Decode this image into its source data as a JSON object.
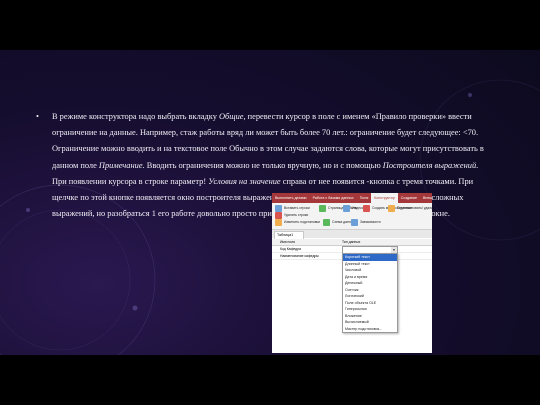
{
  "slide": {
    "bullet": "•",
    "paragraph": [
      {
        "t": "В режиме конструктора надо выбрать вкладку ",
        "i": false
      },
      {
        "t": "Общие",
        "i": true
      },
      {
        "t": ", перевести курсор в поле с именем «Правило проверки» ввести ограничение на данные. Например, стаж работы вряд ли может быть более 70 лет.: ограничение будет следующее: <70. Ограничение можно вводить и на текстовое поле Обычно в этом случае задаются слова, которые могут присутствовать в данном поле ",
        "i": false
      },
      {
        "t": "Примечание",
        "i": true
      },
      {
        "t": ". Вводить ограничения можно не только вручную, но и с помощью ",
        "i": false
      },
      {
        "t": "Построителя выражений",
        "i": true
      },
      {
        "t": ". При появлении курсора в строке параметр! ",
        "i": false
      },
      {
        "t": "Условия на значение",
        "i": true
      },
      {
        "t": " справа от нее появится -кнопка с тремя точками. При щелчке по этой кнопке появляется окно построителя выражений. Обычно им пользуются для построения сложных выражений, но разобраться 1 его работе довольно просто при помощи справки, расположенной в этом же окне.",
        "i": false
      }
    ]
  },
  "screenshot": {
    "tabs": [
      "Выполнить датами",
      "Работа с базами данных",
      "Поля",
      "Конструктор",
      "Создание",
      "Внешние"
    ],
    "active_tab_index": 3,
    "ribbon": {
      "commands": [
        "Вставить строки",
        "Удалить строки",
        "Изменить подстановки",
        "Страница свойств",
        "Индексы",
        "Создать макросы данных",
        "Переименовать/ удалить макрос",
        "Схема данных",
        "Зависимости"
      ],
      "colors": [
        "#6a9fd8",
        "#d9534f",
        "#f0ad4e",
        "#5cb85c"
      ]
    },
    "object_tab": "Таблица1",
    "grid": {
      "headers": [
        "Имя поля",
        "Тип данных"
      ],
      "rows": [
        [
          "Код Кафедра",
          "Короткий текст"
        ],
        [
          "Наименование кафедры",
          "Короткий текст"
        ]
      ]
    },
    "dropdown": {
      "selected": "Короткий текст",
      "options": [
        "Короткий текст",
        "Длинный текст",
        "Числовой",
        "Дата и время",
        "Денежный",
        "Счетчик",
        "Логический",
        "Поле объекта OLE",
        "Гиперссылка",
        "Вложение",
        "Вычисляемый",
        "Мастер подстановок..."
      ],
      "highlight_index": 0
    }
  }
}
